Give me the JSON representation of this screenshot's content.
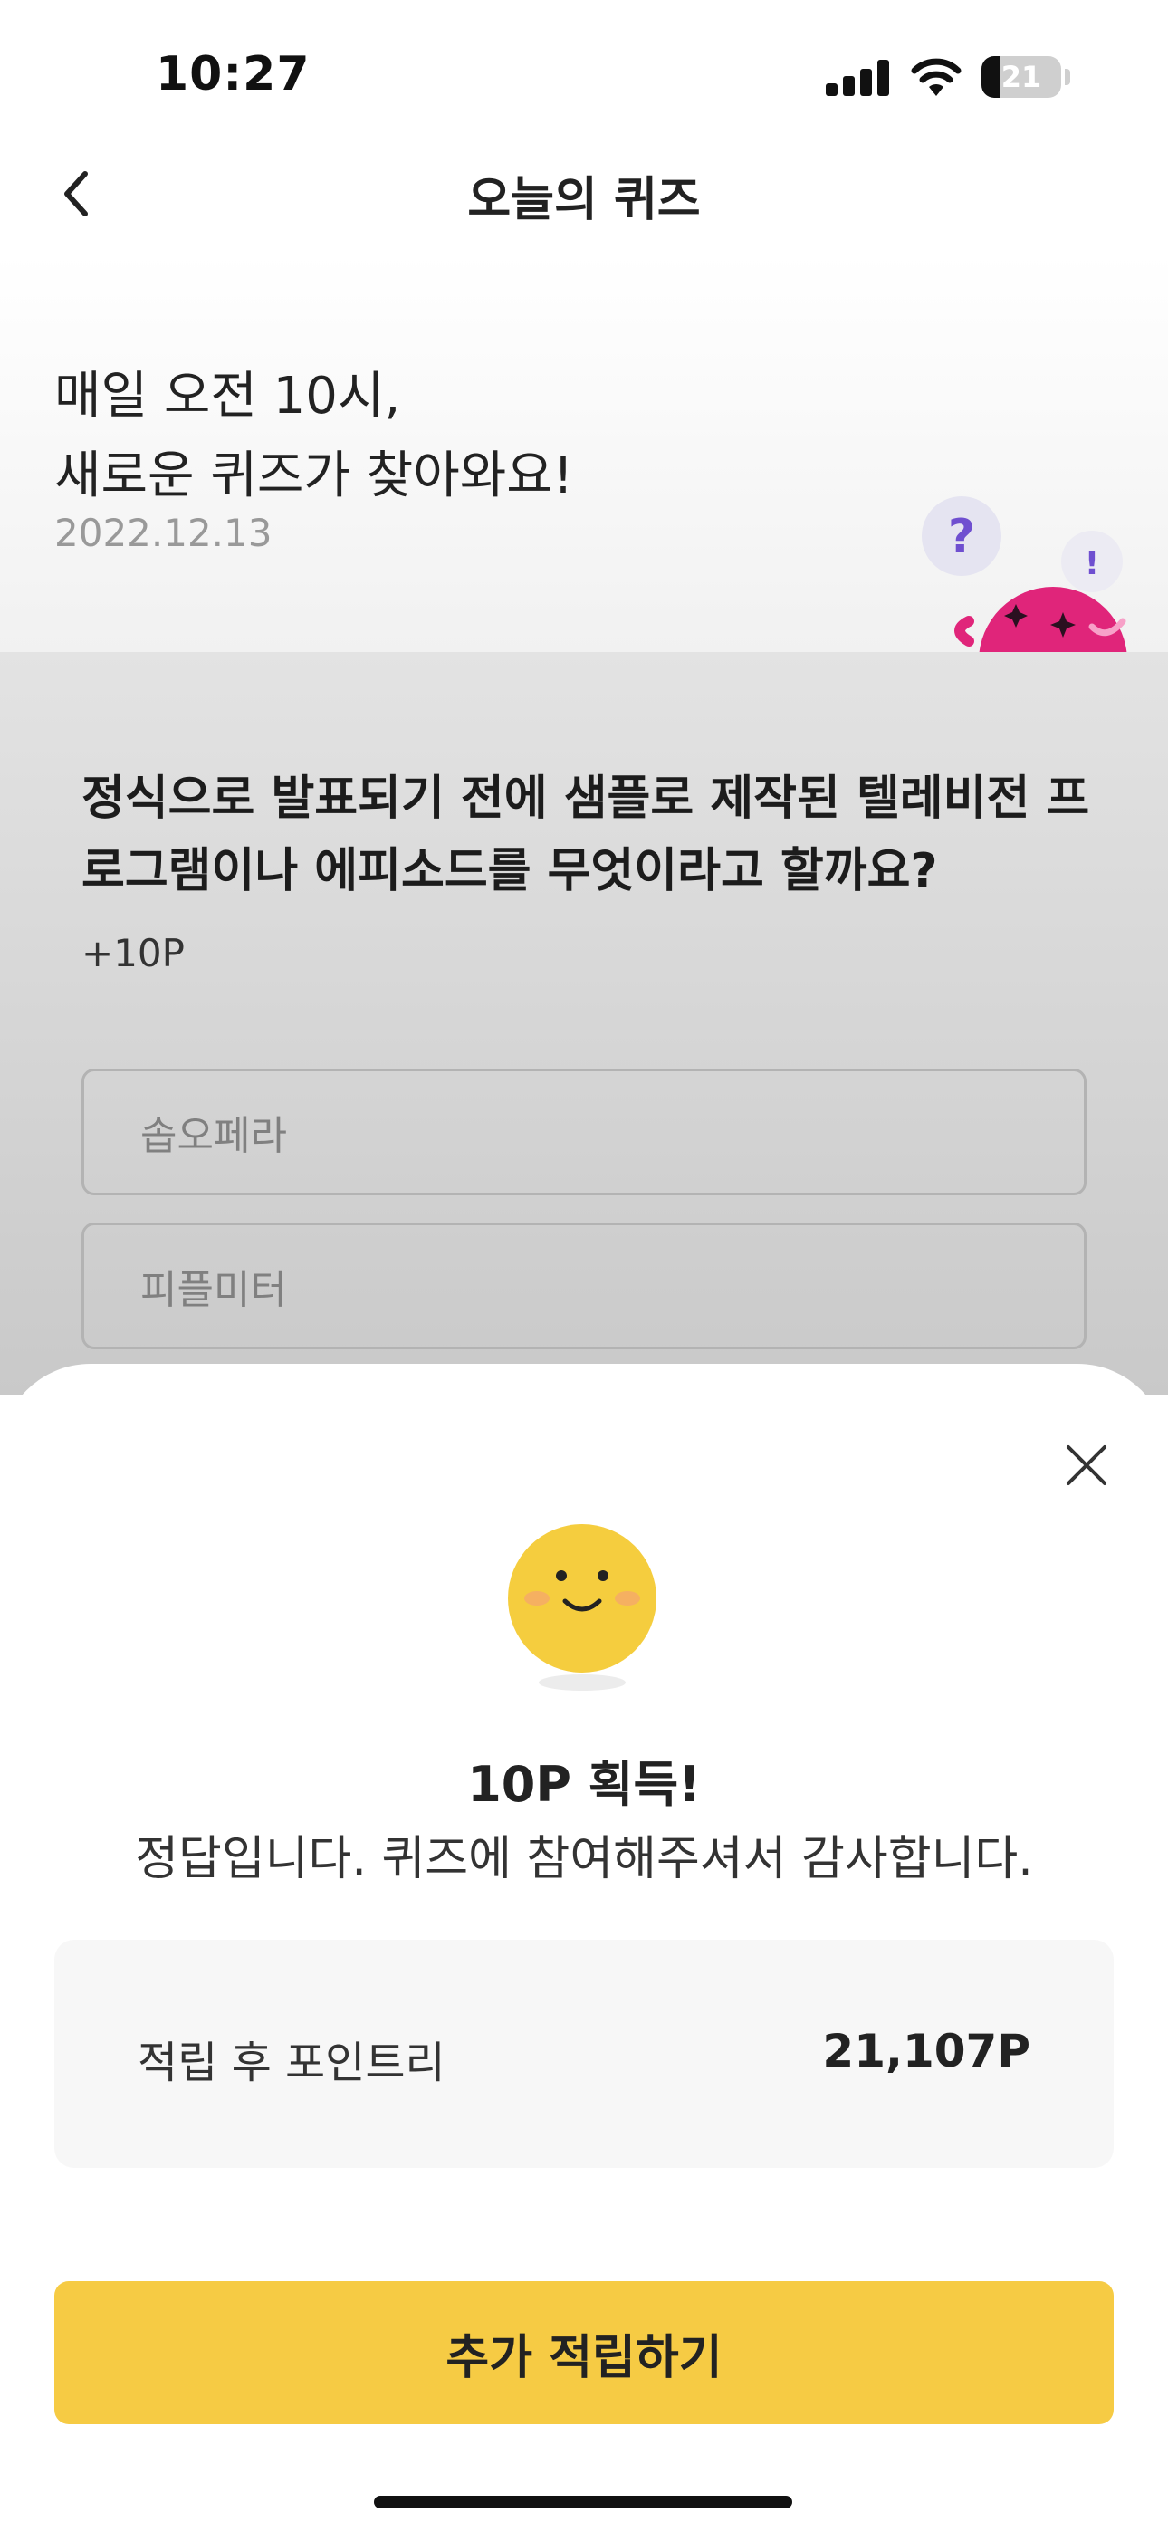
{
  "status_bar": {
    "time": "10:27",
    "battery": "21",
    "icons": [
      "signal-icon",
      "wifi-icon",
      "battery-icon"
    ]
  },
  "nav": {
    "title": "오늘의 퀴즈",
    "back_icon": "chevron-left-icon"
  },
  "hero": {
    "line1": "매일 오전 10시,",
    "line2": "새로운 퀴즈가 찾아와요!",
    "date": "2022.12.13",
    "bubble_question": "?",
    "bubble_exclaim": "!"
  },
  "quiz": {
    "question": "정식으로 발표되기 전에 샘플로 제작된 텔레비전 프로그램이나 에피소드를 무엇이라고 할까요?",
    "points": "+10P",
    "options": [
      "솝오페라",
      "피플미터"
    ]
  },
  "result_sheet": {
    "close_icon": "close-icon",
    "emoji_icon": "smiley-face-icon",
    "title": "10P 획득!",
    "message": "정답입니다. 퀴즈에 참여해주셔서 감사합니다.",
    "points_label": "적립 후 포인트리",
    "points_value": "21,107P",
    "button_label": "추가 적립하기"
  },
  "colors": {
    "accent": "#f6cb44",
    "mascot": "#e0257a",
    "emoji": "#f5cd3e",
    "bubble_text": "#6f4fd0"
  }
}
